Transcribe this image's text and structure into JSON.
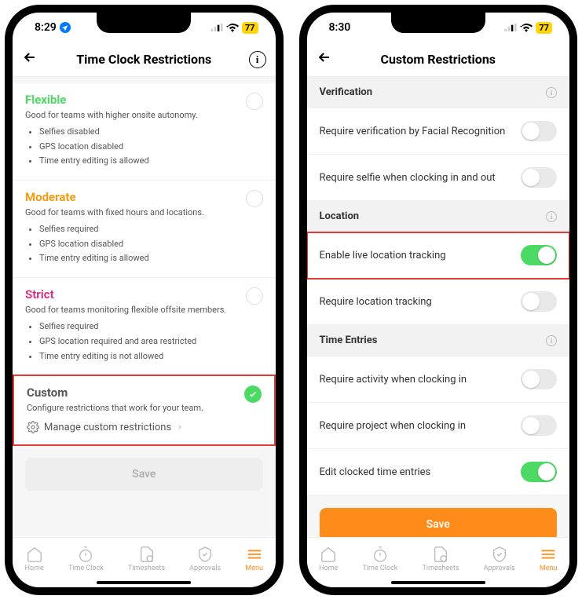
{
  "left": {
    "time": "8:29",
    "battery": "77",
    "title": "Time Clock Restrictions",
    "flexible": {
      "title": "Flexible",
      "sub": "Good for teams with higher onsite autonomy.",
      "b1": "Selfies disabled",
      "b2": "GPS location disabled",
      "b3": "Time entry editing is allowed"
    },
    "moderate": {
      "title": "Moderate",
      "sub": "Good for teams with fixed hours and locations.",
      "b1": "Selfies required",
      "b2": "GPS location disabled",
      "b3": "Time entry editing is allowed"
    },
    "strict": {
      "title": "Strict",
      "sub": "Good for teams monitoring flexible offsite members.",
      "b1": "Selfies required",
      "b2": "GPS location required and area restricted",
      "b3": "Time entry editing is not allowed"
    },
    "custom": {
      "title": "Custom",
      "sub": "Configure restrictions that work for your team.",
      "manage": "Manage custom restrictions"
    },
    "save": "Save"
  },
  "right": {
    "time": "8:30",
    "battery": "77",
    "title": "Custom Restrictions",
    "sec_verification": "Verification",
    "r_facial": "Require verification by Facial Recognition",
    "r_selfie": "Require selfie when clocking in and out",
    "sec_location": "Location",
    "r_live": "Enable live location tracking",
    "r_reqloc": "Require location tracking",
    "sec_time": "Time Entries",
    "r_activity": "Require activity when clocking in",
    "r_project": "Require project when clocking in",
    "r_edit": "Edit clocked time entries",
    "save": "Save"
  },
  "tabs": {
    "home": "Home",
    "clock": "Time Clock",
    "sheets": "Timesheets",
    "approvals": "Approvals",
    "menu": "Menu"
  }
}
